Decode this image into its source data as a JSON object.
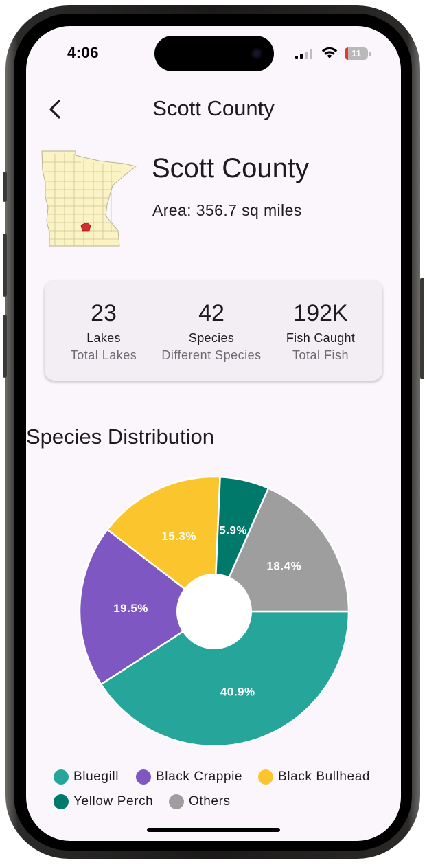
{
  "status_bar": {
    "time": "4:06",
    "battery_level": "11",
    "signal_bars": 2,
    "icons": [
      "signal-icon",
      "wifi-icon",
      "battery-icon"
    ]
  },
  "nav": {
    "title": "Scott County",
    "back_icon": "chevron-left-icon"
  },
  "county": {
    "name": "Scott County",
    "area": "Area: 356.7 sq miles",
    "map_icon": "minnesota-map-icon"
  },
  "stats": [
    {
      "value": "23",
      "label": "Lakes",
      "sublabel": "Total Lakes"
    },
    {
      "value": "42",
      "label": "Species",
      "sublabel": "Different Species"
    },
    {
      "value": "192K",
      "label": "Fish Caught",
      "sublabel": "Total Fish"
    }
  ],
  "section": {
    "title": "Species Distribution"
  },
  "colors": {
    "background": "#fbf6fb",
    "bluegill": "#26a69a",
    "black_crappie": "#7e57c2",
    "black_bullhead": "#fbc62d",
    "yellow_perch": "#00796b",
    "others": "#9e9e9e",
    "county_highlight": "#d32f2f",
    "map_fill": "#fbf3c4"
  },
  "chart_data": {
    "type": "pie",
    "categories": [
      "Bluegill",
      "Black Crappie",
      "Black Bullhead",
      "Yellow Perch",
      "Others"
    ],
    "values": [
      40.9,
      19.5,
      15.3,
      5.9,
      18.4
    ],
    "labels": [
      "40.9%",
      "19.5%",
      "15.3%",
      "5.9%",
      "18.4%"
    ],
    "colors": [
      "#26a69a",
      "#7e57c2",
      "#fbc62d",
      "#00796b",
      "#9e9e9e"
    ],
    "donut_hole": true,
    "legend_position": "bottom"
  }
}
